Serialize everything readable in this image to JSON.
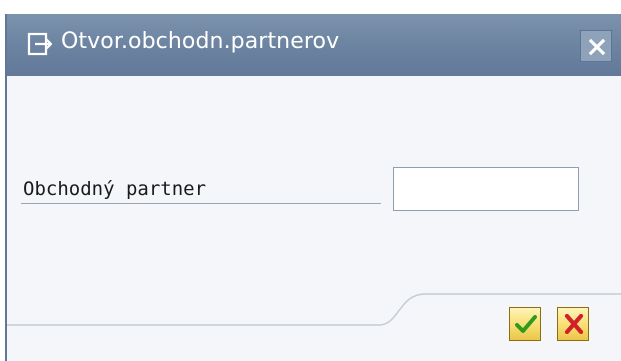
{
  "dialog": {
    "title": "Otvor.obchodn.partnerov",
    "title_icon": "open-dialog-icon",
    "close_icon": "close-icon"
  },
  "form": {
    "field_label": "Obchodný partner",
    "field_value": "",
    "field_placeholder": ""
  },
  "footer": {
    "confirm_icon": "checkmark-icon",
    "cancel_icon": "cancel-x-icon"
  },
  "colors": {
    "titlebar": "#6c84a1",
    "dialog_bg": "#f4f6f9",
    "confirm_green": "#2e9b1f",
    "cancel_red": "#d0202a",
    "button_yellow": "#f8de72"
  }
}
